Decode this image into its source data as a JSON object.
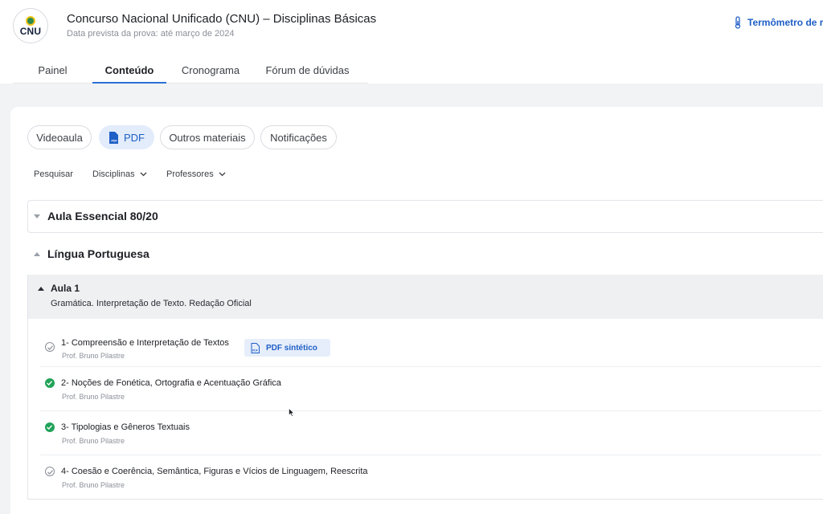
{
  "header": {
    "logo_text": "CNU",
    "title": "Concurso Nacional Unificado (CNU) – Disciplinas Básicas",
    "subtitle": "Data prevista da prova: até março de 2024",
    "thermometer_label": "Termômetro de r"
  },
  "tabs": [
    {
      "label": "Painel",
      "active": false
    },
    {
      "label": "Conteúdo",
      "active": true
    },
    {
      "label": "Cronograma",
      "active": false
    },
    {
      "label": "Fórum de dúvidas",
      "active": false
    }
  ],
  "chips": [
    {
      "label": "Videoaula",
      "active": false
    },
    {
      "label": "PDF",
      "active": true,
      "icon": "pdf-file-icon"
    },
    {
      "label": "Outros materiais",
      "active": false
    },
    {
      "label": "Notificações",
      "active": false
    }
  ],
  "filters": [
    {
      "label": "Pesquisar"
    },
    {
      "label": "Disciplinas"
    },
    {
      "label": "Professores"
    }
  ],
  "sections": [
    {
      "title": "Aula Essencial 80/20",
      "expanded": false
    },
    {
      "title": "Língua Portuguesa",
      "expanded": true
    }
  ],
  "aula": {
    "label": "Aula 1",
    "description": "Gramática. Interpretação de Texto. Redação Oficial"
  },
  "items": [
    {
      "title": "1- Compreensão e Interpretação de Textos",
      "professor": "Prof. Bruno Pilastre",
      "status": "pending",
      "badge": "PDF sintético"
    },
    {
      "title": "2- Noções de Fonética, Ortografia e Acentuação Gráfica",
      "professor": "Prof. Bruno Pilastre",
      "status": "done"
    },
    {
      "title": "3- Tipologias e Gêneros Textuais",
      "professor": "Prof. Bruno Pilastre",
      "status": "done"
    },
    {
      "title": "4- Coesão e Coerência, Semântica, Figuras e Vícios de Linguagem, Reescrita",
      "professor": "Prof. Bruno Pilastre",
      "status": "pending"
    }
  ],
  "colors": {
    "accent": "#1f5fc6",
    "done": "#22a35a",
    "page_bg": "#f2f3f4"
  }
}
